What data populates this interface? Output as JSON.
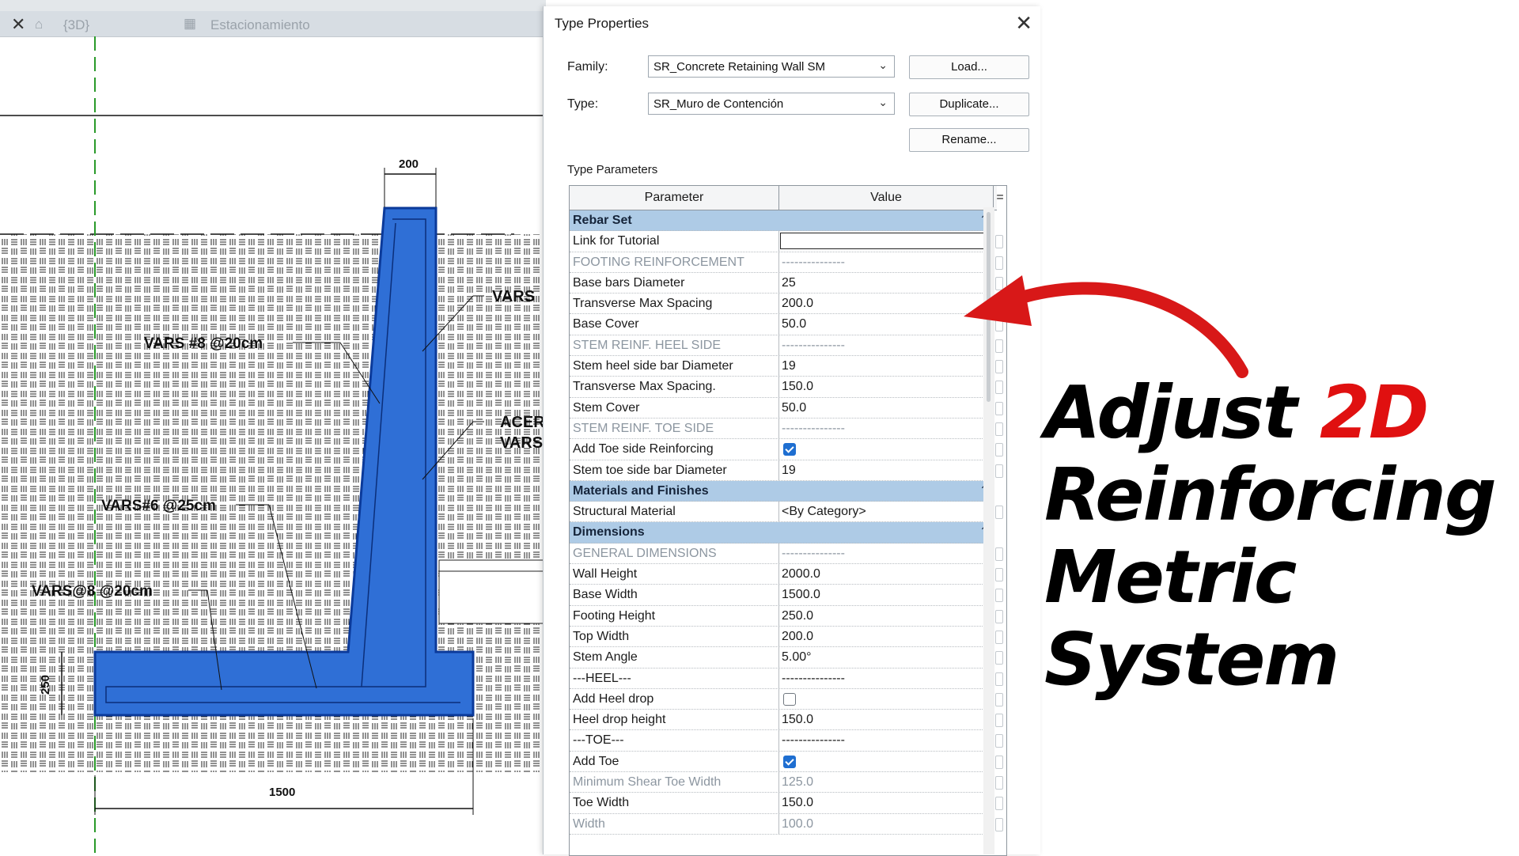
{
  "tabs": {
    "close_glyph": "✕",
    "view_3d": "{3D}",
    "view_parking": "Estacionamiento"
  },
  "drawing": {
    "dim_top": "200",
    "dim_bottom": "1500",
    "dim_left": "250",
    "label_1": "VARS #8 @20cm",
    "label_2": "VARS#6 @25cm",
    "label_3": "VARS@8 @20cm",
    "label_4": "VARS",
    "label_5": "ACER",
    "label_6": "VARS",
    "wall_color": "#2f6fd6",
    "wall_outline": "#0b3a9a"
  },
  "dialog": {
    "title": "Type Properties",
    "family_label": "Family:",
    "family_value": "SR_Concrete Retaining Wall SM",
    "type_label": "Type:",
    "type_value": "SR_Muro de Contención",
    "load_button": "Load...",
    "duplicate_button": "Duplicate...",
    "rename_button": "Rename...",
    "type_parameters_label": "Type Parameters",
    "col_parameter": "Parameter",
    "col_value": "Value",
    "col_eq": "=",
    "rows": [
      {
        "kind": "group",
        "p": "Rebar Set",
        "v": ""
      },
      {
        "kind": "input",
        "p": "Link for Tutorial",
        "v": ""
      },
      {
        "kind": "sub",
        "p": "FOOTING REINFORCEMENT",
        "v": "---------------"
      },
      {
        "kind": "normal",
        "p": "Base bars Diameter",
        "v": "25"
      },
      {
        "kind": "normal",
        "p": "Transverse Max Spacing",
        "v": "200.0"
      },
      {
        "kind": "normal",
        "p": "Base Cover",
        "v": "50.0"
      },
      {
        "kind": "sub",
        "p": "STEM REINF. HEEL SIDE",
        "v": "---------------"
      },
      {
        "kind": "normal",
        "p": "Stem heel side bar Diameter",
        "v": "19"
      },
      {
        "kind": "normal",
        "p": "Transverse Max Spacing.",
        "v": "150.0"
      },
      {
        "kind": "normal",
        "p": "Stem Cover",
        "v": "50.0"
      },
      {
        "kind": "sub",
        "p": "STEM REINF. TOE SIDE",
        "v": "---------------"
      },
      {
        "kind": "check",
        "p": "Add Toe side Reinforcing",
        "v": "",
        "checked": true
      },
      {
        "kind": "normal",
        "p": "Stem toe side bar Diameter",
        "v": "19"
      },
      {
        "kind": "group",
        "p": "Materials and Finishes",
        "v": ""
      },
      {
        "kind": "normal",
        "p": "Structural Material",
        "v": "<By Category>"
      },
      {
        "kind": "group",
        "p": "Dimensions",
        "v": ""
      },
      {
        "kind": "sub",
        "p": "GENERAL DIMENSIONS",
        "v": "---------------"
      },
      {
        "kind": "normal",
        "p": "Wall Height",
        "v": "2000.0"
      },
      {
        "kind": "normal",
        "p": "Base Width",
        "v": "1500.0"
      },
      {
        "kind": "normal",
        "p": "Footing Height",
        "v": "250.0"
      },
      {
        "kind": "normal",
        "p": "Top Width",
        "v": "200.0"
      },
      {
        "kind": "normal",
        "p": "Stem Angle",
        "v": "5.00°"
      },
      {
        "kind": "normal",
        "p": "---HEEL---",
        "v": "---------------"
      },
      {
        "kind": "check",
        "p": "Add Heel drop",
        "v": "",
        "checked": false
      },
      {
        "kind": "normal",
        "p": "Heel drop height",
        "v": "150.0"
      },
      {
        "kind": "normal",
        "p": "---TOE---",
        "v": "---------------"
      },
      {
        "kind": "check",
        "p": "Add Toe",
        "v": "",
        "checked": true
      },
      {
        "kind": "dim",
        "p": "Minimum Shear Toe Width",
        "v": "125.0"
      },
      {
        "kind": "normal",
        "p": "Toe Width",
        "v": "150.0"
      },
      {
        "kind": "dim",
        "p": "Width",
        "v": "100.0"
      }
    ]
  },
  "overlay": {
    "line1_a": "Adjust ",
    "line1_b": "2D",
    "line2": "Reinforcing",
    "line3": "Metric",
    "line4": "System",
    "accent_color": "#e01010"
  }
}
